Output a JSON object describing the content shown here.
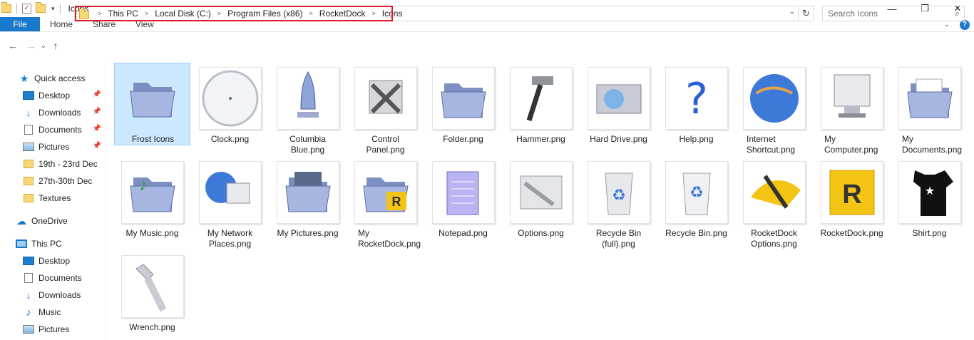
{
  "window": {
    "title": "Icons"
  },
  "window_controls": {
    "minimize": "—",
    "maximize": "❐",
    "close": "✕"
  },
  "ribbon": {
    "file": "File",
    "tabs": [
      "Home",
      "Share",
      "View"
    ],
    "expand_glyph": "⌄",
    "help_glyph": "?"
  },
  "nav": {
    "back": "←",
    "forward": "→",
    "recent": "⌄",
    "up": "↑"
  },
  "address": {
    "crumbs": [
      "This PC",
      "Local Disk (C:)",
      "Program Files (x86)",
      "RocketDock",
      "Icons"
    ]
  },
  "search": {
    "placeholder": "Search Icons"
  },
  "sidebar": {
    "quick_access": "Quick access",
    "quick_items": [
      {
        "label": "Desktop",
        "icon": "desktop-icon",
        "pinned": true
      },
      {
        "label": "Downloads",
        "icon": "downloads-icon",
        "pinned": true
      },
      {
        "label": "Documents",
        "icon": "documents-icon",
        "pinned": true
      },
      {
        "label": "Pictures",
        "icon": "pictures-icon",
        "pinned": true
      },
      {
        "label": "19th - 23rd Dec",
        "icon": "folder-icon",
        "pinned": false
      },
      {
        "label": "27th-30th Dec",
        "icon": "folder-icon",
        "pinned": false
      },
      {
        "label": "Textures",
        "icon": "folder-icon",
        "pinned": false
      }
    ],
    "onedrive": "OneDrive",
    "this_pc": "This PC",
    "pc_items": [
      {
        "label": "Desktop",
        "icon": "desktop-icon"
      },
      {
        "label": "Documents",
        "icon": "documents-icon"
      },
      {
        "label": "Downloads",
        "icon": "downloads-icon"
      },
      {
        "label": "Music",
        "icon": "music-icon"
      },
      {
        "label": "Pictures",
        "icon": "pictures-icon"
      }
    ]
  },
  "files": [
    {
      "line1": "Frost Icons",
      "line2": "",
      "icon": "folder-icon",
      "selected": true
    },
    {
      "line1": "Clock.png",
      "line2": "",
      "icon": "clock-icon"
    },
    {
      "line1": "Columbia",
      "line2": "Blue.png",
      "icon": "shuttle-icon"
    },
    {
      "line1": "Control",
      "line2": "Panel.png",
      "icon": "tools-icon"
    },
    {
      "line1": "Folder.png",
      "line2": "",
      "icon": "folder-icon"
    },
    {
      "line1": "Hammer.png",
      "line2": "",
      "icon": "hammer-icon"
    },
    {
      "line1": "Hard Drive.png",
      "line2": "",
      "icon": "hard-drive-icon"
    },
    {
      "line1": "Help.png",
      "line2": "",
      "icon": "help-icon"
    },
    {
      "line1": "Internet",
      "line2": "Shortcut.png",
      "icon": "globe-icon"
    },
    {
      "line1": "My",
      "line2": "Computer.png",
      "icon": "computer-icon"
    },
    {
      "line1": "My",
      "line2": "Documents.png",
      "icon": "documents-folder-icon"
    },
    {
      "line1": "My Music.png",
      "line2": "",
      "icon": "music-folder-icon"
    },
    {
      "line1": "My Network",
      "line2": "Places.png",
      "icon": "network-icon"
    },
    {
      "line1": "My Pictures.png",
      "line2": "",
      "icon": "pictures-folder-icon"
    },
    {
      "line1": "My",
      "line2": "RocketDock.png",
      "icon": "rocketdock-folder-icon"
    },
    {
      "line1": "Notepad.png",
      "line2": "",
      "icon": "notepad-icon"
    },
    {
      "line1": "Options.png",
      "line2": "",
      "icon": "options-icon"
    },
    {
      "line1": "Recycle Bin",
      "line2": "(full).png",
      "icon": "recycle-bin-full-icon"
    },
    {
      "line1": "Recycle Bin.png",
      "line2": "",
      "icon": "recycle-bin-icon"
    },
    {
      "line1": "RocketDock",
      "line2": "Options.png",
      "icon": "rocketdock-options-icon"
    },
    {
      "line1": "RocketDock.png",
      "line2": "",
      "icon": "rocketdock-icon"
    },
    {
      "line1": "Shirt.png",
      "line2": "",
      "icon": "shirt-icon"
    },
    {
      "line1": "Wrench.png",
      "line2": "",
      "icon": "wrench-icon"
    }
  ]
}
